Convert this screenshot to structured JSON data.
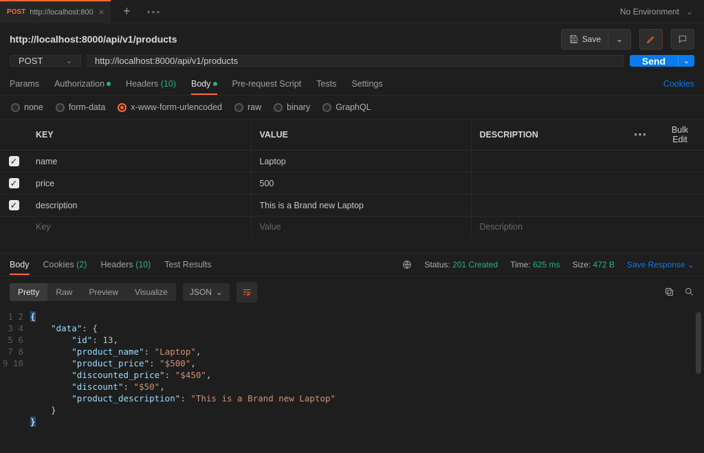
{
  "tab": {
    "method": "POST",
    "title": "http://localhost:800"
  },
  "environment": "No Environment",
  "header": {
    "title": "http://localhost:8000/api/v1/products",
    "save_label": "Save"
  },
  "request": {
    "method": "POST",
    "url": "http://localhost:8000/api/v1/products",
    "send_label": "Send",
    "tabs": {
      "params": "Params",
      "auth": "Authorization",
      "headers": "Headers",
      "headers_count": "(10)",
      "body": "Body",
      "prereq": "Pre-request Script",
      "tests": "Tests",
      "settings": "Settings",
      "cookies": "Cookies"
    },
    "body_types": {
      "none": "none",
      "formdata": "form-data",
      "urlencoded": "x-www-form-urlencoded",
      "raw": "raw",
      "binary": "binary",
      "graphql": "GraphQL"
    },
    "table": {
      "h_key": "KEY",
      "h_value": "VALUE",
      "h_desc": "DESCRIPTION",
      "bulk": "Bulk Edit",
      "rows": [
        {
          "key": "name",
          "value": "Laptop"
        },
        {
          "key": "price",
          "value": "500"
        },
        {
          "key": "description",
          "value": "This is a Brand new Laptop"
        }
      ],
      "ph_key": "Key",
      "ph_value": "Value",
      "ph_desc": "Description"
    }
  },
  "response": {
    "tabs": {
      "body": "Body",
      "cookies": "Cookies",
      "cookies_count": "(2)",
      "headers": "Headers",
      "headers_count": "(10)",
      "tests": "Test Results"
    },
    "status_label": "Status:",
    "status_value": "201 Created",
    "time_label": "Time:",
    "time_value": "625 ms",
    "size_label": "Size:",
    "size_value": "472 B",
    "save": "Save Response",
    "viewer": {
      "pretty": "Pretty",
      "raw": "Raw",
      "preview": "Preview",
      "visualize": "Visualize",
      "format": "JSON"
    },
    "json": {
      "data_k": "\"data\"",
      "id_k": "\"id\"",
      "id_v": "13",
      "pn_k": "\"product_name\"",
      "pn_v": "\"Laptop\"",
      "pp_k": "\"product_price\"",
      "pp_v": "\"$500\"",
      "dp_k": "\"discounted_price\"",
      "dp_v": "\"$450\"",
      "d_k": "\"discount\"",
      "d_v": "\"$50\"",
      "pd_k": "\"product_description\"",
      "pd_v": "\"This is a Brand new Laptop\""
    }
  }
}
